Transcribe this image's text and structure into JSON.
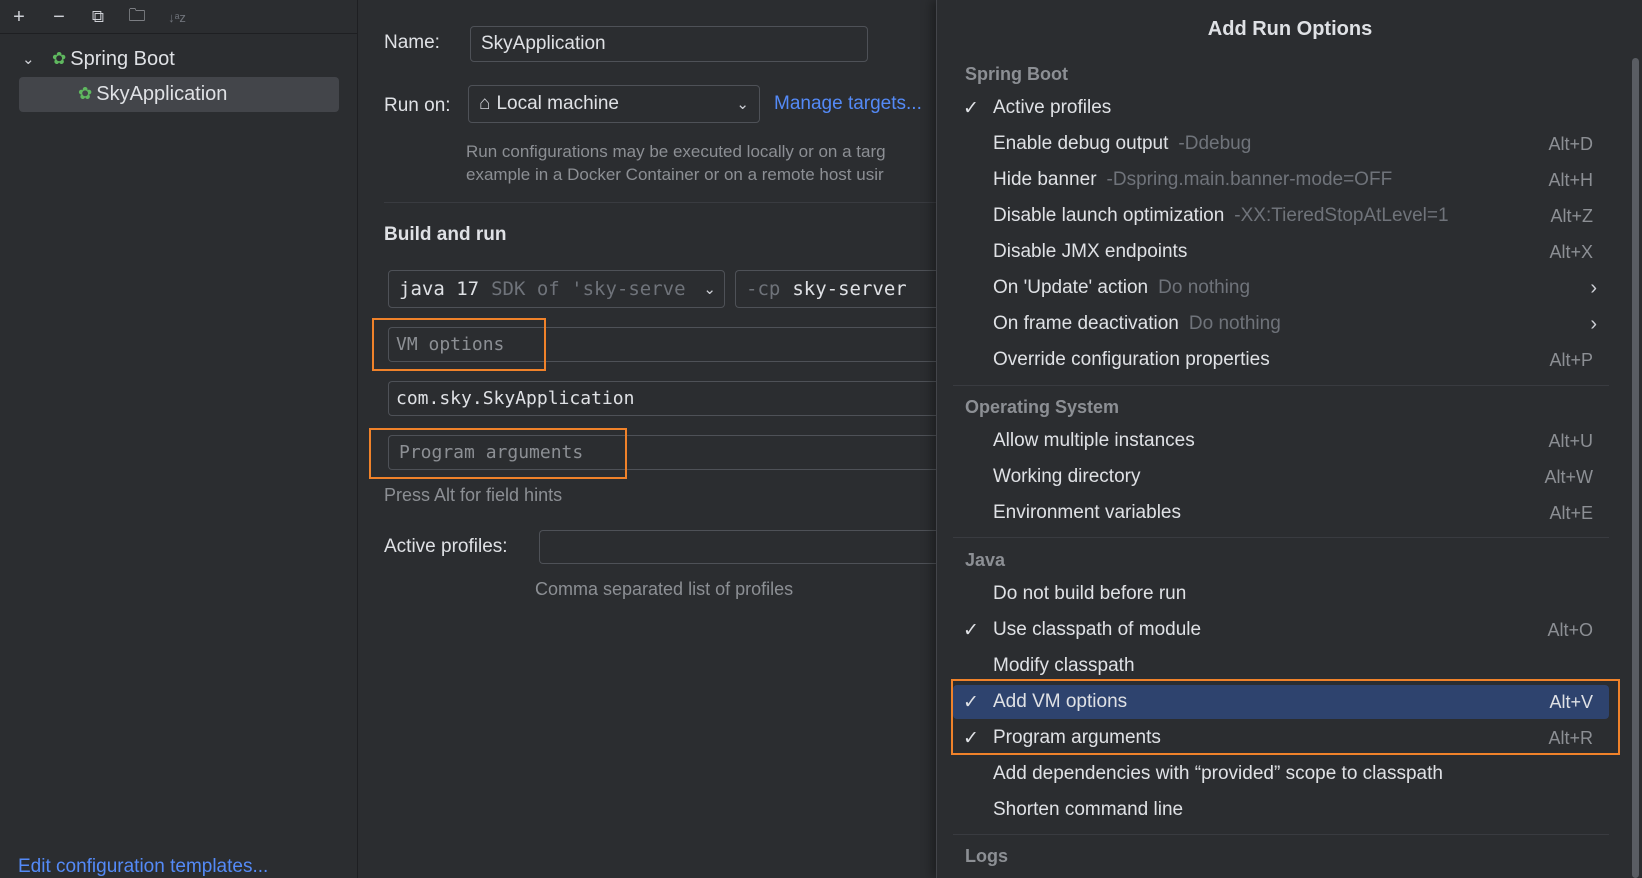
{
  "toolbar": {
    "add": "+",
    "remove": "−",
    "copy": "⧉",
    "folder": "🗀",
    "sort": "↓ᵃz"
  },
  "tree": {
    "group": "Spring Boot",
    "item": "SkyApplication"
  },
  "edit_templates": "Edit configuration templates...",
  "form": {
    "name_label": "Name:",
    "name_value": "SkyApplication",
    "run_on_label": "Run on:",
    "run_on_value": "Local machine",
    "manage_targets": "Manage targets...",
    "run_hint_1": "Run configurations may be executed locally or on a targ",
    "run_hint_2": "example in a Docker Container or on a remote host usir",
    "build_and_run": "Build and run",
    "sdk_main": "java 17",
    "sdk_sub": "SDK of 'sky-serve",
    "cp_prefix": "-cp",
    "cp_value": "sky-server",
    "vm_options_placeholder": "VM options",
    "main_class": "com.sky.SkyApplication",
    "program_args_placeholder": "Program arguments",
    "alt_hint": "Press Alt for field hints",
    "active_profiles_label": "Active profiles:",
    "profiles_hint": "Comma separated list of profiles"
  },
  "popup": {
    "title": "Add Run Options",
    "groups": {
      "spring": "Spring Boot",
      "os": "Operating System",
      "java": "Java",
      "logs": "Logs"
    },
    "spring_items": [
      {
        "check": "✓",
        "label": "Active profiles",
        "sub": "",
        "shortcut": ""
      },
      {
        "check": "",
        "label": "Enable debug output",
        "sub": "-Ddebug",
        "shortcut": "Alt+D"
      },
      {
        "check": "",
        "label": "Hide banner",
        "sub": "-Dspring.main.banner-mode=OFF",
        "shortcut": "Alt+H"
      },
      {
        "check": "",
        "label": "Disable launch optimization",
        "sub": "-XX:TieredStopAtLevel=1",
        "shortcut": "Alt+Z"
      },
      {
        "check": "",
        "label": "Disable JMX endpoints",
        "sub": "",
        "shortcut": "Alt+X"
      },
      {
        "check": "",
        "label": "On 'Update' action",
        "sub": "Do nothing",
        "shortcut": "",
        "arrow": "›"
      },
      {
        "check": "",
        "label": "On frame deactivation",
        "sub": "Do nothing",
        "shortcut": "",
        "arrow": "›"
      },
      {
        "check": "",
        "label": "Override configuration properties",
        "sub": "",
        "shortcut": "Alt+P"
      }
    ],
    "os_items": [
      {
        "check": "",
        "label": "Allow multiple instances",
        "sub": "",
        "shortcut": "Alt+U"
      },
      {
        "check": "",
        "label": "Working directory",
        "sub": "",
        "shortcut": "Alt+W"
      },
      {
        "check": "",
        "label": "Environment variables",
        "sub": "",
        "shortcut": "Alt+E"
      }
    ],
    "java_items": [
      {
        "check": "",
        "label": "Do not build before run",
        "sub": "",
        "shortcut": ""
      },
      {
        "check": "✓",
        "label": "Use classpath of module",
        "sub": "",
        "shortcut": "Alt+O"
      },
      {
        "check": "",
        "label": "Modify classpath",
        "sub": "",
        "shortcut": ""
      },
      {
        "check": "✓",
        "label": "Add VM options",
        "sub": "",
        "shortcut": "Alt+V"
      },
      {
        "check": "✓",
        "label": "Program arguments",
        "sub": "",
        "shortcut": "Alt+R"
      },
      {
        "check": "",
        "label": "Add dependencies with “provided” scope to classpath",
        "sub": "",
        "shortcut": ""
      },
      {
        "check": "",
        "label": "Shorten command line",
        "sub": "",
        "shortcut": ""
      }
    ]
  },
  "colors": {
    "accent": "#548af7",
    "highlight_box": "#f0822a",
    "selection": "#2e436e"
  }
}
